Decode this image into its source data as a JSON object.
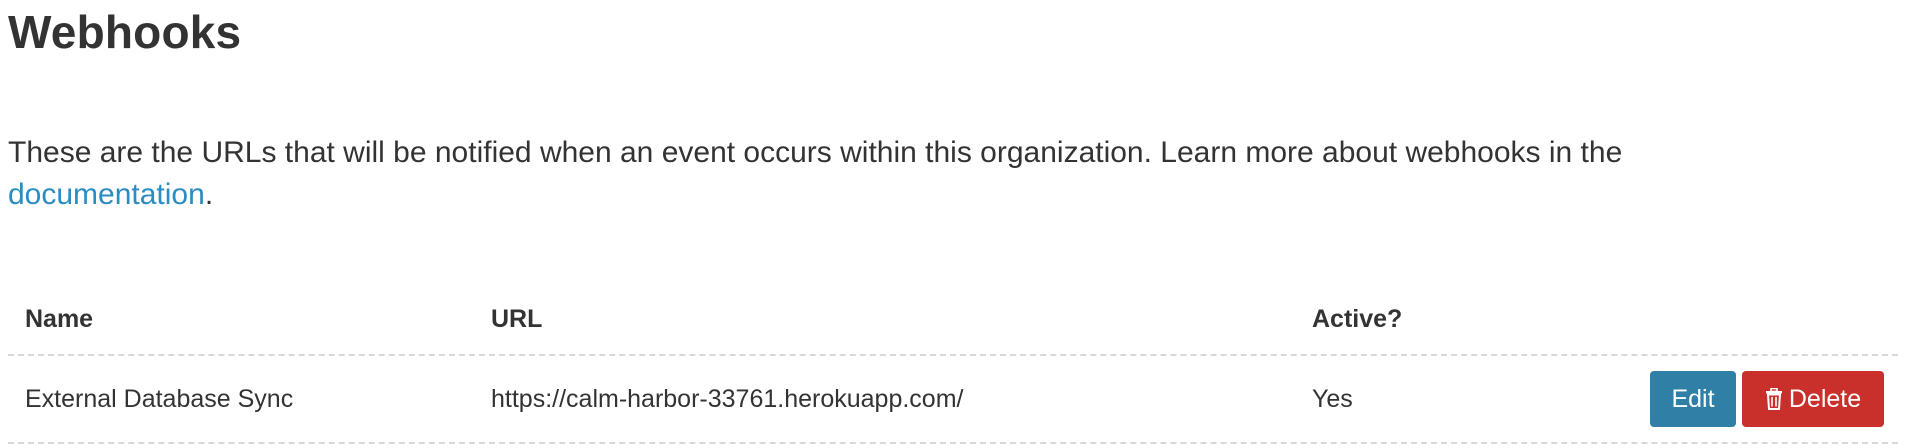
{
  "page": {
    "title": "Webhooks",
    "intro_text": "These are the URLs that will be notified when an event occurs within this organization. Learn more about webhooks in the",
    "intro_link": "documentation",
    "intro_end": "."
  },
  "table": {
    "headers": {
      "name": "Name",
      "url": "URL",
      "active": "Active?"
    },
    "rows": [
      {
        "name": "External Database Sync",
        "url": "https://calm-harbor-33761.herokuapp.com/",
        "active": "Yes",
        "edit_label": "Edit",
        "delete_label": "Delete"
      }
    ]
  },
  "colors": {
    "link": "#2a8cc0",
    "edit_button": "#2f7fa6",
    "delete_button": "#c9302c"
  },
  "icons": {
    "delete": "trash-icon"
  }
}
